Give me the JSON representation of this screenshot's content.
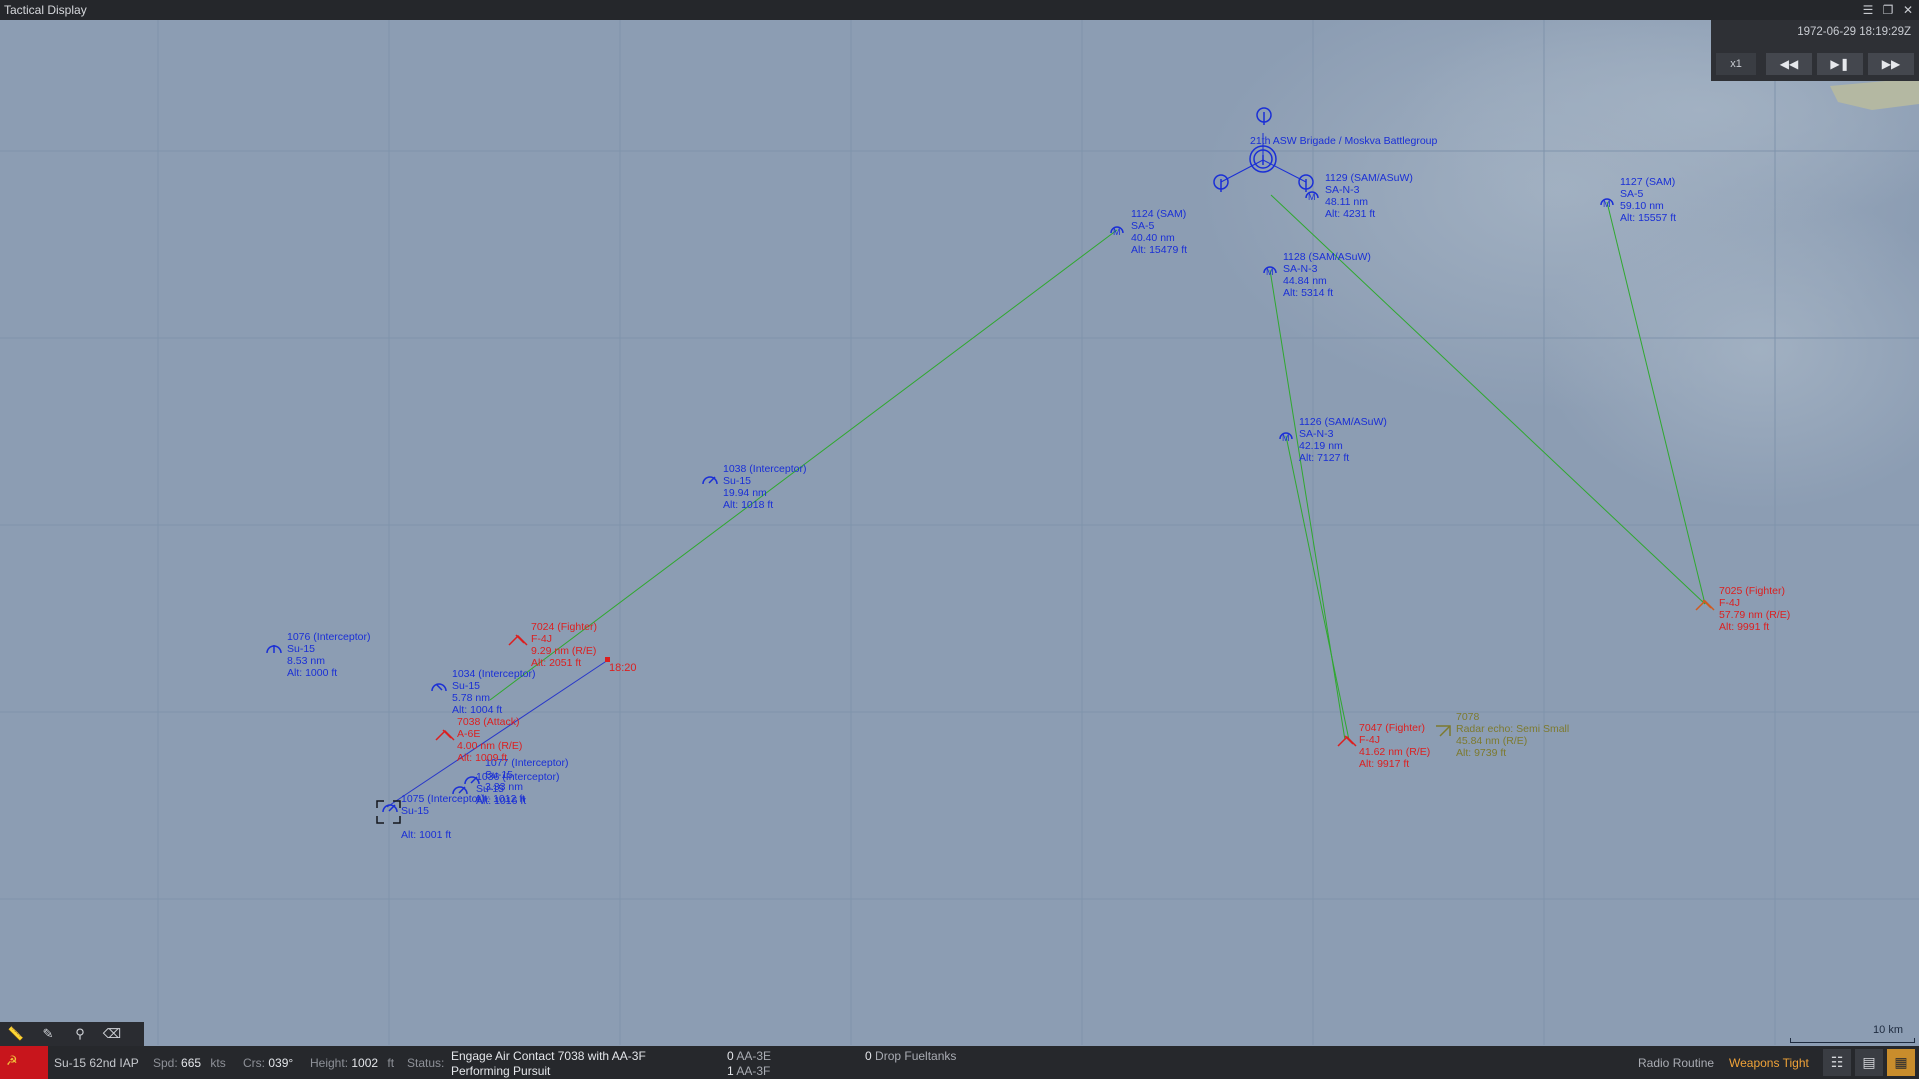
{
  "window": {
    "title": "Tactical Display"
  },
  "time": {
    "datetime": "1972-06-29 18:19:29Z",
    "speed": "x1"
  },
  "colors": {
    "friendly": "#1a2fd6",
    "hostile": "#dc1f1f",
    "unknown": "#7d7a2e",
    "sea": "#8c9db3"
  },
  "map": {
    "group_label": "21th ASW Brigade / Moskva Battlegroup",
    "time_marker": "18:20",
    "units": [
      {
        "id": "u1129",
        "lines": [
          "1129 (SAM/ASuW)",
          "SA-N-3",
          "48.11 nm",
          "Alt: 4231 ft"
        ],
        "side": "friendly"
      },
      {
        "id": "u1127",
        "lines": [
          "1127 (SAM)",
          "SA-5",
          "59.10 nm",
          "Alt: 15557 ft"
        ],
        "side": "friendly"
      },
      {
        "id": "u1124",
        "lines": [
          "1124 (SAM)",
          "SA-5",
          "40.40 nm",
          "Alt: 15479 ft"
        ],
        "side": "friendly"
      },
      {
        "id": "u1128",
        "lines": [
          "1128 (SAM/ASuW)",
          "SA-N-3",
          "44.84 nm",
          "Alt: 5314 ft"
        ],
        "side": "friendly"
      },
      {
        "id": "u1126",
        "lines": [
          "1126 (SAM/ASuW)",
          "SA-N-3",
          "42.19 nm",
          "Alt: 7127 ft"
        ],
        "side": "friendly"
      },
      {
        "id": "u1038",
        "lines": [
          "1038 (Interceptor)",
          "Su-15",
          "19.94 nm",
          "Alt: 1018 ft"
        ],
        "side": "friendly"
      },
      {
        "id": "u1076",
        "lines": [
          "1076 (Interceptor)",
          "Su-15",
          "8.53 nm",
          "Alt: 1000 ft"
        ],
        "side": "friendly"
      },
      {
        "id": "u1034",
        "lines": [
          "1034 (Interceptor)",
          "Su-15",
          "5.78 nm",
          "Alt: 1004 ft"
        ],
        "side": "friendly"
      },
      {
        "id": "u1077",
        "lines": [
          "1077 (Interceptor)",
          "Su-15",
          "3.33 nm",
          "Alt: 1012 ft"
        ],
        "side": "friendly"
      },
      {
        "id": "u1036",
        "lines": [
          "1036 (Interceptor)",
          "Su-15",
          "Alt: 1016 ft"
        ],
        "side": "friendly"
      },
      {
        "id": "u1075",
        "lines": [
          "1075 (Interceptor)",
          "Su-15",
          "Alt: 1001 ft"
        ],
        "side": "friendly"
      },
      {
        "id": "h7024",
        "lines": [
          "7024 (Fighter)",
          "F-4J",
          "9.29 nm (R/E)",
          "Alt: 2051 ft"
        ],
        "side": "hostile"
      },
      {
        "id": "h7038",
        "lines": [
          "7038 (Attack)",
          "A-6E",
          "4.00 nm (R/E)",
          "Alt: 1009 ft"
        ],
        "side": "hostile"
      },
      {
        "id": "h7047",
        "lines": [
          "7047 (Fighter)",
          "F-4J",
          "41.62 nm (R/E)",
          "Alt: 9917 ft"
        ],
        "side": "hostile"
      },
      {
        "id": "h7025",
        "lines": [
          "7025 (Fighter)",
          "F-4J",
          "57.79 nm (R/E)",
          "Alt: 9991 ft"
        ],
        "side": "hostile"
      },
      {
        "id": "k7078",
        "lines": [
          "7078",
          "Radar echo: Semi Small",
          "45.84 nm (R/E)",
          "Alt: 9739 ft"
        ],
        "side": "unknown"
      }
    ]
  },
  "scale": {
    "label": "10 km"
  },
  "toolbar": {
    "tools": [
      "ruler-icon",
      "pencil-icon",
      "pin-icon",
      "eraser-icon"
    ]
  },
  "status": {
    "unit_name": "Su-15 62nd IAP",
    "spd_label": "Spd:",
    "spd_value": "665",
    "spd_unit": "kts",
    "crs_label": "Crs:",
    "crs_value": "039°",
    "height_label": "Height:",
    "height_value": "1002",
    "height_unit": "ft",
    "status_label": "Status:",
    "status_line1": "Engage Air Contact 7038 with AA-3F",
    "status_line2": "Performing Pursuit",
    "weapons": [
      {
        "count": "0",
        "name": "AA-3E"
      },
      {
        "count": "1",
        "name": "AA-3F"
      }
    ],
    "fuel_count": "0",
    "fuel_label": "Drop Fueltanks",
    "emcon": "Radio Routine",
    "roe": "Weapons Tight"
  }
}
